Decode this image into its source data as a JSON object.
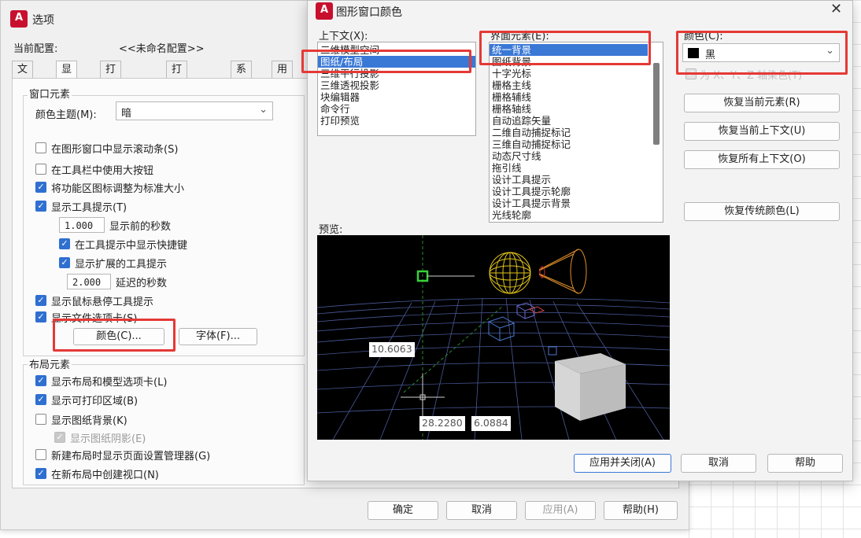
{
  "options_dialog": {
    "title": "选项",
    "app_icon_letter": "A",
    "profile_label": "当前配置:",
    "profile_value": "<<未命名配置>>",
    "tabs": [
      "文件",
      "显示",
      "打开和保存",
      "打印和发布",
      "系统",
      "用户"
    ],
    "active_tab": "显示",
    "window_elements": {
      "group_label": "窗口元素",
      "color_theme_label": "颜色主题(M):",
      "color_theme_value": "暗",
      "checks": [
        {
          "label": "在图形窗口中显示滚动条(S)",
          "checked": false
        },
        {
          "label": "在工具栏中使用大按钮",
          "checked": false
        },
        {
          "label": "将功能区图标调整为标准大小",
          "checked": true
        },
        {
          "label": "显示工具提示(T)",
          "checked": true
        }
      ],
      "seconds_before_value": "1.000",
      "seconds_before_label": "显示前的秒数",
      "sub_checks": [
        {
          "label": "在工具提示中显示快捷键",
          "checked": true
        },
        {
          "label": "显示扩展的工具提示",
          "checked": true
        }
      ],
      "delay_value": "2.000",
      "delay_label": "延迟的秒数",
      "checks2": [
        {
          "label": "显示鼠标悬停工具提示",
          "checked": true
        },
        {
          "label": "显示文件选项卡(S)",
          "checked": true
        }
      ],
      "colors_button": "颜色(C)...",
      "fonts_button": "字体(F)..."
    },
    "layout_elements": {
      "group_label": "布局元素",
      "checks": [
        {
          "label": "显示布局和模型选项卡(L)",
          "checked": true,
          "disabled": false
        },
        {
          "label": "显示可打印区域(B)",
          "checked": true,
          "disabled": false
        },
        {
          "label": "显示图纸背景(K)",
          "checked": false,
          "disabled": false
        },
        {
          "label": "显示图纸阴影(E)",
          "checked": true,
          "disabled": true
        },
        {
          "label": "新建布局时显示页面设置管理器(G)",
          "checked": false,
          "disabled": false
        },
        {
          "label": "在新布局中创建视口(N)",
          "checked": true,
          "disabled": false
        }
      ]
    },
    "footer_buttons": {
      "ok": "确定",
      "cancel": "取消",
      "apply": "应用(A)",
      "help": "帮助(H)"
    }
  },
  "color_dialog": {
    "title": "图形窗口颜色",
    "close_glyph": "✕",
    "context_label": "上下文(X):",
    "contexts": [
      "二维模型空间",
      "图纸/布局",
      "三维平行投影",
      "三维透视投影",
      "块编辑器",
      "命令行",
      "打印预览"
    ],
    "selected_context": "图纸/布局",
    "interface_label": "界面元素(E):",
    "interface_elements": [
      "统一背景",
      "图纸背景",
      "十字光标",
      "栅格主线",
      "栅格辅线",
      "栅格轴线",
      "自动追踪矢量",
      "二维自动捕捉标记",
      "三维自动捕捉标记",
      "动态尺寸线",
      "拖引线",
      "设计工具提示",
      "设计工具提示轮廓",
      "设计工具提示背景",
      "光线轮廓"
    ],
    "selected_element": "统一背景",
    "color_label": "颜色(C):",
    "color_value": "黑",
    "color_swatch": "#000000",
    "tint_label": "为 X、Y、Z 轴染色(T)",
    "buttons": {
      "restore_current_element": "恢复当前元素(R)",
      "restore_current_context": "恢复当前上下文(U)",
      "restore_all_contexts": "恢复所有上下文(O)",
      "restore_classic_colors": "恢复传统颜色(L)"
    },
    "preview_label": "预览:",
    "preview_readouts": {
      "distance": "10.6063",
      "x": "28.2280",
      "y": "6.0884"
    },
    "footer": {
      "apply_close": "应用并关闭(A)",
      "cancel": "取消",
      "help": "帮助"
    },
    "highlight_color": "#e53935",
    "accent_color": "#3a78d6"
  }
}
